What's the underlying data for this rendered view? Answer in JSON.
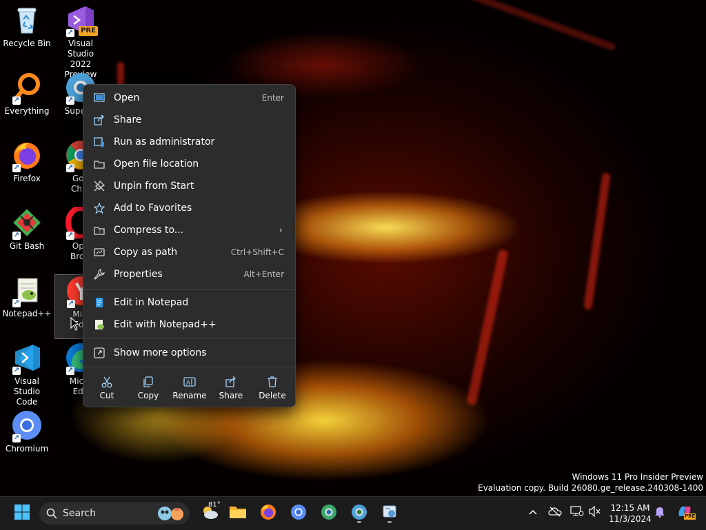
{
  "desktop": {
    "icons": [
      {
        "label": "Recycle Bin",
        "icon": "recycle-bin-icon"
      },
      {
        "label": "Visual Studio 2022 Preview",
        "label_line1": "Visual Studio",
        "label_line2": "2022 Preview",
        "badge": "PRE",
        "icon": "visual-studio-preview-icon"
      },
      {
        "label": "Everything",
        "icon": "everything-search-icon"
      },
      {
        "label": "Superm",
        "icon": "supermium-icon"
      },
      {
        "label": "Firefox",
        "icon": "firefox-icon"
      },
      {
        "label_line1": "Goo",
        "label_line2": "Chro",
        "icon": "google-chrome-icon"
      },
      {
        "label": "Git Bash",
        "icon": "git-bash-icon"
      },
      {
        "label_line1": "Ope",
        "label_line2": "Brow",
        "icon": "opera-browser-icon"
      },
      {
        "label": "Notepad++",
        "icon": "notepad-plus-plus-icon"
      },
      {
        "label_line1": "Micr",
        "label_line2": "Edg",
        "icon": "yandex-icon"
      },
      {
        "label_line1": "Visual Studio",
        "label_line2": "Code",
        "icon": "vscode-icon"
      },
      {
        "label_line1": "Micro",
        "label_line2": "Edg",
        "icon": "microsoft-edge-icon"
      },
      {
        "label": "Chromium",
        "icon": "chromium-icon"
      }
    ]
  },
  "context_menu": {
    "items": [
      {
        "label": "Open",
        "shortcut": "Enter",
        "icon": "open-icon"
      },
      {
        "label": "Share",
        "shortcut": "",
        "icon": "share-icon"
      },
      {
        "label": "Run as administrator",
        "shortcut": "",
        "icon": "shield-icon"
      },
      {
        "label": "Open file location",
        "shortcut": "",
        "icon": "folder-icon"
      },
      {
        "label": "Unpin from Start",
        "shortcut": "",
        "icon": "unpin-icon"
      },
      {
        "label": "Add to Favorites",
        "shortcut": "",
        "icon": "star-icon"
      },
      {
        "label": "Compress to...",
        "shortcut": "",
        "icon": "zip-icon"
      },
      {
        "label": "Copy as path",
        "shortcut": "Ctrl+Shift+C",
        "icon": "path-icon"
      },
      {
        "label": "Properties",
        "shortcut": "Alt+Enter",
        "icon": "wrench-icon"
      }
    ],
    "app_items": [
      {
        "label": "Edit in Notepad",
        "icon": "notepad-icon"
      },
      {
        "label": "Edit with Notepad++",
        "icon": "notepad-plus-plus-icon"
      }
    ],
    "more_options": {
      "label": "Show more options",
      "icon": "more-options-icon"
    },
    "quick_actions": [
      {
        "label": "Cut",
        "icon": "scissors-icon"
      },
      {
        "label": "Copy",
        "icon": "copy-icon"
      },
      {
        "label": "Rename",
        "icon": "rename-icon"
      },
      {
        "label": "Share",
        "icon": "share-icon"
      },
      {
        "label": "Delete",
        "icon": "trash-icon"
      }
    ]
  },
  "watermark": {
    "line1": "Windows 11 Pro Insider Preview",
    "line2": "Evaluation copy. Build 26080.ge_release.240308-1400"
  },
  "taskbar": {
    "search_placeholder": "Search",
    "weather_temp": "81°",
    "clock_time": "12:15 AM",
    "clock_date": "11/3/2024",
    "copilot_badge": "PRE"
  },
  "colors": {
    "menu_bg": "#2c2c2c",
    "taskbar_bg": "#1c1c1c",
    "accent": "#4cc2ff"
  }
}
